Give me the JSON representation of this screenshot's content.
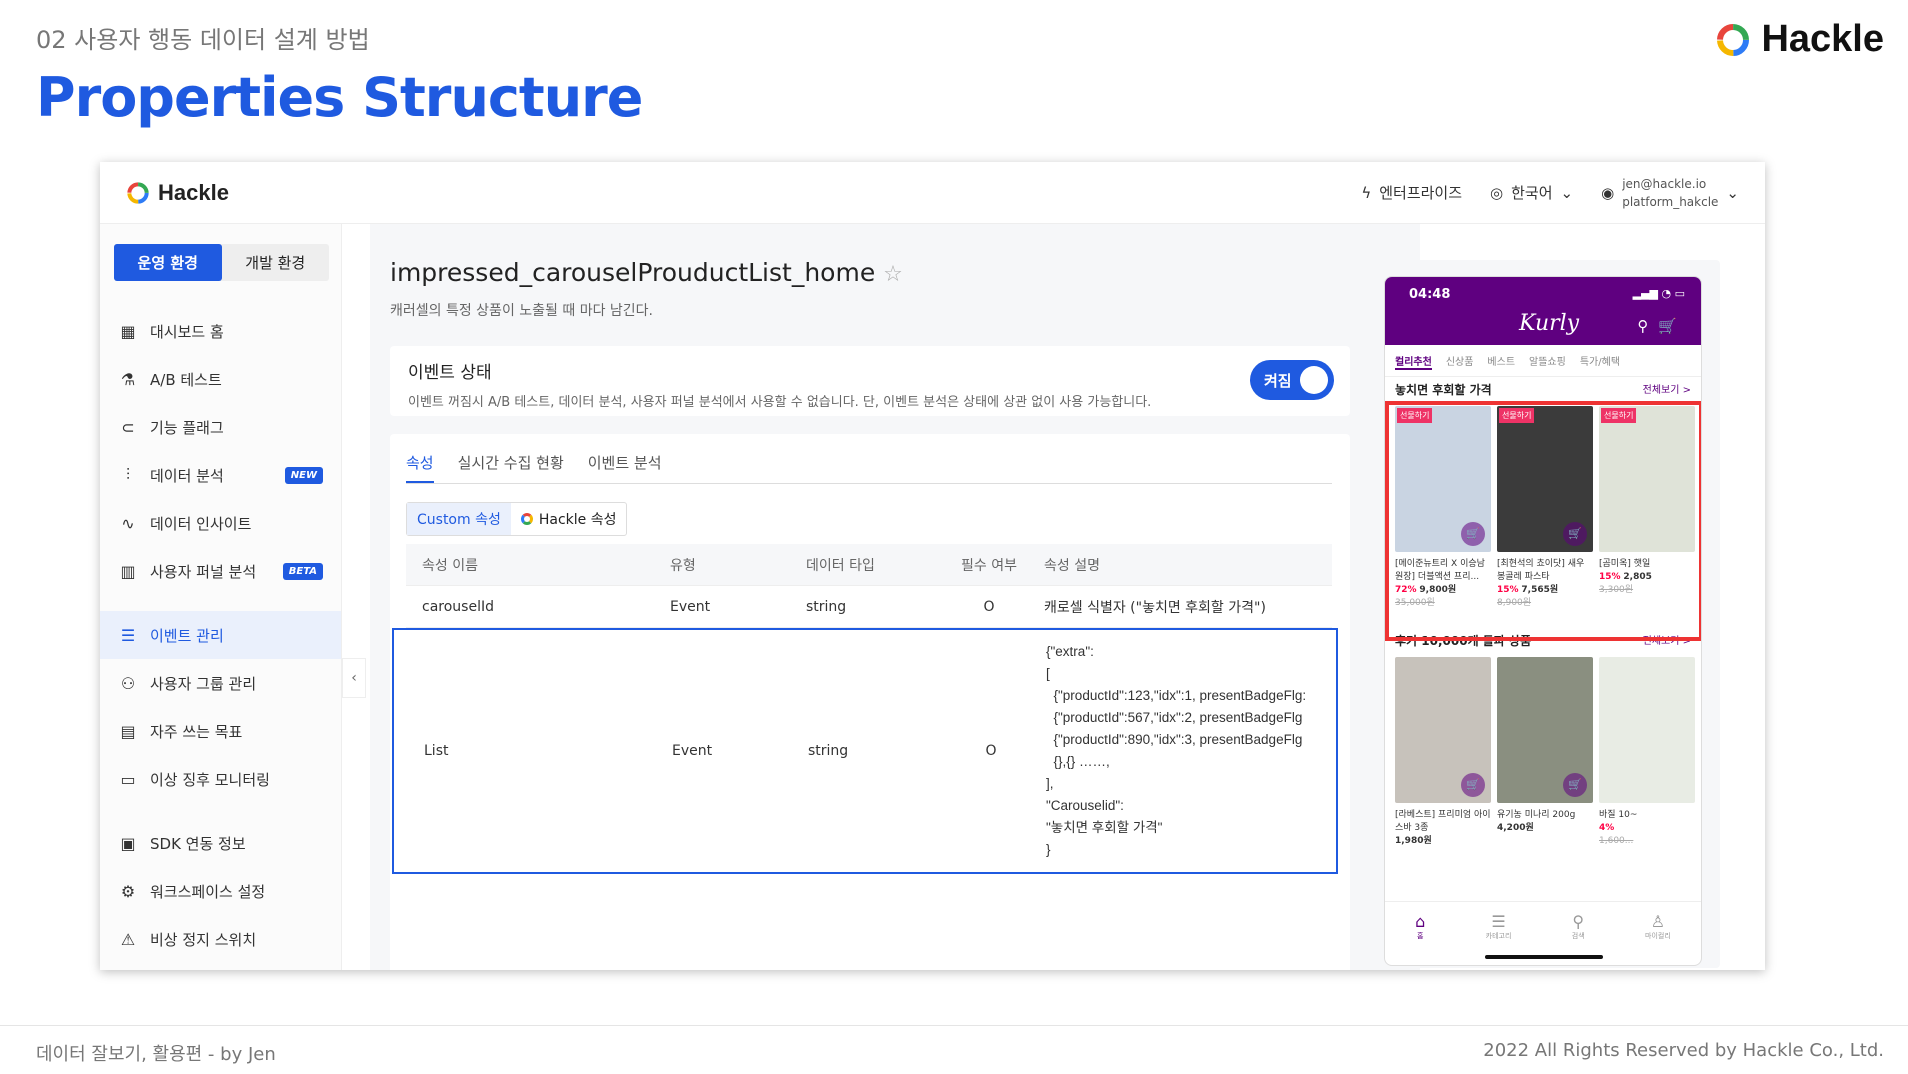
{
  "slide": {
    "crumb": "02 사용자 행동 데이터 설계 방법",
    "title": "Properties Structure",
    "brand": "Hackle",
    "footer_left": "데이터 잘보기, 활용편 - by Jen",
    "footer_right": "2022 All Rights Reserved by Hackle Co., Ltd."
  },
  "app": {
    "logo": "Hackle",
    "topbar": {
      "enterprise": "엔터프라이즈",
      "language": "한국어",
      "email": "jen@hackle.io",
      "workspace": "platform_hakcle"
    },
    "env": {
      "prod": "운영 환경",
      "dev": "개발 환경"
    },
    "nav": [
      {
        "label": "대시보드 홈",
        "icon": "layout-icon"
      },
      {
        "label": "A/B 테스트",
        "icon": "flask-icon"
      },
      {
        "label": "기능 플래그",
        "icon": "toggle-icon"
      },
      {
        "label": "데이터 분석",
        "icon": "sliders-icon",
        "badge": "NEW"
      },
      {
        "label": "데이터 인사이트",
        "icon": "pulse-icon"
      },
      {
        "label": "사용자 퍼널 분석",
        "icon": "bar-chart-icon",
        "badge": "BETA"
      },
      {
        "label": "이벤트 관리",
        "icon": "event-icon",
        "active": true
      },
      {
        "label": "사용자 그룹 관리",
        "icon": "users-icon"
      },
      {
        "label": "자주 쓰는 목표",
        "icon": "chart-box-icon"
      },
      {
        "label": "이상 징후 모니터링",
        "icon": "monitor-icon"
      },
      {
        "label": "SDK 연동 정보",
        "icon": "sdk-icon"
      },
      {
        "label": "워크스페이스 설정",
        "icon": "gear-icon"
      },
      {
        "label": "비상 정지 스위치",
        "icon": "warning-icon"
      }
    ],
    "event": {
      "name": "impressed_carouselProuductList_home",
      "description": "캐러셀의 특정 상품이 노출될 때 마다 남긴다.",
      "status_title": "이벤트 상태",
      "status_desc": "이벤트 꺼짐시 A/B 테스트, 데이터 분석, 사용자 퍼널 분석에서 사용할 수 없습니다. 단, 이벤트 분석은 상태에 상관 없이 사용 가능합니다.",
      "toggle_label": "켜짐"
    },
    "tabs": [
      "속성",
      "실시간 수집 현황",
      "이벤트 분석"
    ],
    "segments": {
      "custom": "Custom 속성",
      "hackle": "Hackle 속성"
    },
    "table": {
      "headers": [
        "속성 이름",
        "유형",
        "데이터 타입",
        "필수 여부",
        "속성 설명"
      ],
      "rows": [
        {
          "name": "carouselId",
          "type": "Event",
          "dtype": "string",
          "required": "O",
          "desc": "캐로셀 식별자 (\"놓치면 후회할 가격\")"
        },
        {
          "name": "List",
          "type": "Event",
          "dtype": "string",
          "required": "O",
          "desc": "{\"extra\":\n[\n  {\"productId\":123,\"idx\":1, presentBadgeFlg:\n  {\"productId\":567,\"idx\":2, presentBadgeFlg\n  {\"productId\":890,\"idx\":3, presentBadgeFlg\n  {},{} ……,\n],\n\"Carouselid\":\n\"놓치면 후회할 가격\"\n}"
        }
      ]
    }
  },
  "phone": {
    "time": "04:48",
    "logo": "Kurly",
    "tabs": [
      "컬리추천",
      "신상품",
      "베스트",
      "알뜰쇼핑",
      "특가/혜택"
    ],
    "section1": {
      "title": "놓치면 후회할 가격",
      "more": "전체보기 >"
    },
    "section1_products": [
      {
        "tag": "선물하기",
        "name": "[메이준뉴트리 X 이승남 원장] 더블액션 프리...",
        "disc": "72%",
        "price": "9,800원",
        "orig": "35,000원",
        "color": "#c9d4e2"
      },
      {
        "tag": "선물하기",
        "name": "[최현석의 쵸이닷] 새우 봉골레 파스타",
        "disc": "15%",
        "price": "7,565원",
        "orig": "8,900원",
        "color": "#3b3b3b"
      },
      {
        "tag": "선물하기",
        "name": "[곰미옥] 햇일",
        "disc": "15%",
        "price": "2,805",
        "orig": "3,300원",
        "color": "#dfe3d8"
      }
    ],
    "section2": {
      "title": "후기 10,000개 돌파 상품",
      "more": "전체보기 >"
    },
    "section2_products": [
      {
        "name": "[라베스트] 프리미엄 아이스바 3종",
        "price": "1,980원",
        "color": "#c7c2bb"
      },
      {
        "name": "유기농 미나리 200g",
        "price": "4,200원",
        "color": "#8a8f80"
      },
      {
        "name": "바질 10~",
        "disc": "4%",
        "orig": "1,600...",
        "color": "#e8ece4"
      }
    ],
    "nav": [
      "홈",
      "카테고리",
      "검색",
      "마이컬리"
    ]
  }
}
